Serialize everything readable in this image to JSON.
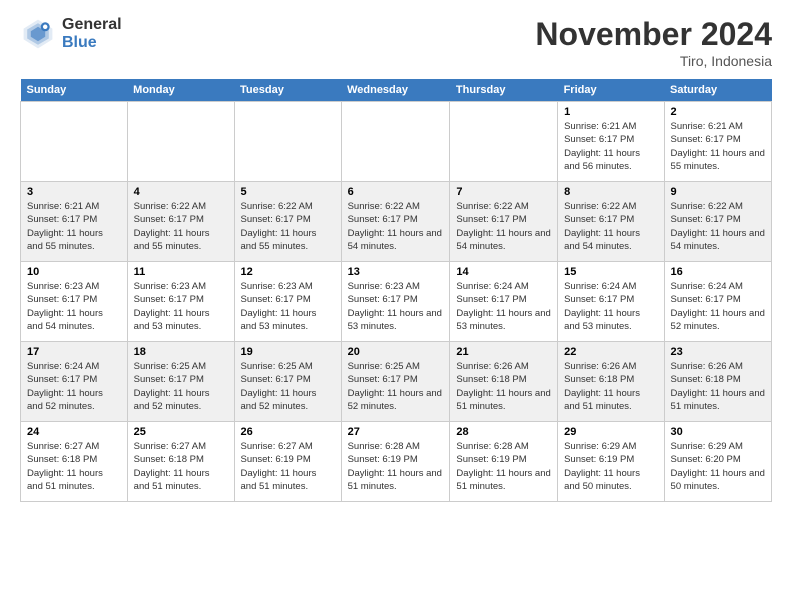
{
  "app": {
    "logo_general": "General",
    "logo_blue": "Blue"
  },
  "header": {
    "title": "November 2024",
    "subtitle": "Tiro, Indonesia"
  },
  "days_of_week": [
    "Sunday",
    "Monday",
    "Tuesday",
    "Wednesday",
    "Thursday",
    "Friday",
    "Saturday"
  ],
  "weeks": [
    {
      "id": "week1",
      "days": [
        {
          "num": "",
          "info": ""
        },
        {
          "num": "",
          "info": ""
        },
        {
          "num": "",
          "info": ""
        },
        {
          "num": "",
          "info": ""
        },
        {
          "num": "",
          "info": ""
        },
        {
          "num": "1",
          "info": "Sunrise: 6:21 AM\nSunset: 6:17 PM\nDaylight: 11 hours and 56 minutes."
        },
        {
          "num": "2",
          "info": "Sunrise: 6:21 AM\nSunset: 6:17 PM\nDaylight: 11 hours and 55 minutes."
        }
      ]
    },
    {
      "id": "week2",
      "days": [
        {
          "num": "3",
          "info": "Sunrise: 6:21 AM\nSunset: 6:17 PM\nDaylight: 11 hours and 55 minutes."
        },
        {
          "num": "4",
          "info": "Sunrise: 6:22 AM\nSunset: 6:17 PM\nDaylight: 11 hours and 55 minutes."
        },
        {
          "num": "5",
          "info": "Sunrise: 6:22 AM\nSunset: 6:17 PM\nDaylight: 11 hours and 55 minutes."
        },
        {
          "num": "6",
          "info": "Sunrise: 6:22 AM\nSunset: 6:17 PM\nDaylight: 11 hours and 54 minutes."
        },
        {
          "num": "7",
          "info": "Sunrise: 6:22 AM\nSunset: 6:17 PM\nDaylight: 11 hours and 54 minutes."
        },
        {
          "num": "8",
          "info": "Sunrise: 6:22 AM\nSunset: 6:17 PM\nDaylight: 11 hours and 54 minutes."
        },
        {
          "num": "9",
          "info": "Sunrise: 6:22 AM\nSunset: 6:17 PM\nDaylight: 11 hours and 54 minutes."
        }
      ]
    },
    {
      "id": "week3",
      "days": [
        {
          "num": "10",
          "info": "Sunrise: 6:23 AM\nSunset: 6:17 PM\nDaylight: 11 hours and 54 minutes."
        },
        {
          "num": "11",
          "info": "Sunrise: 6:23 AM\nSunset: 6:17 PM\nDaylight: 11 hours and 53 minutes."
        },
        {
          "num": "12",
          "info": "Sunrise: 6:23 AM\nSunset: 6:17 PM\nDaylight: 11 hours and 53 minutes."
        },
        {
          "num": "13",
          "info": "Sunrise: 6:23 AM\nSunset: 6:17 PM\nDaylight: 11 hours and 53 minutes."
        },
        {
          "num": "14",
          "info": "Sunrise: 6:24 AM\nSunset: 6:17 PM\nDaylight: 11 hours and 53 minutes."
        },
        {
          "num": "15",
          "info": "Sunrise: 6:24 AM\nSunset: 6:17 PM\nDaylight: 11 hours and 53 minutes."
        },
        {
          "num": "16",
          "info": "Sunrise: 6:24 AM\nSunset: 6:17 PM\nDaylight: 11 hours and 52 minutes."
        }
      ]
    },
    {
      "id": "week4",
      "days": [
        {
          "num": "17",
          "info": "Sunrise: 6:24 AM\nSunset: 6:17 PM\nDaylight: 11 hours and 52 minutes."
        },
        {
          "num": "18",
          "info": "Sunrise: 6:25 AM\nSunset: 6:17 PM\nDaylight: 11 hours and 52 minutes."
        },
        {
          "num": "19",
          "info": "Sunrise: 6:25 AM\nSunset: 6:17 PM\nDaylight: 11 hours and 52 minutes."
        },
        {
          "num": "20",
          "info": "Sunrise: 6:25 AM\nSunset: 6:17 PM\nDaylight: 11 hours and 52 minutes."
        },
        {
          "num": "21",
          "info": "Sunrise: 6:26 AM\nSunset: 6:18 PM\nDaylight: 11 hours and 51 minutes."
        },
        {
          "num": "22",
          "info": "Sunrise: 6:26 AM\nSunset: 6:18 PM\nDaylight: 11 hours and 51 minutes."
        },
        {
          "num": "23",
          "info": "Sunrise: 6:26 AM\nSunset: 6:18 PM\nDaylight: 11 hours and 51 minutes."
        }
      ]
    },
    {
      "id": "week5",
      "days": [
        {
          "num": "24",
          "info": "Sunrise: 6:27 AM\nSunset: 6:18 PM\nDaylight: 11 hours and 51 minutes."
        },
        {
          "num": "25",
          "info": "Sunrise: 6:27 AM\nSunset: 6:18 PM\nDaylight: 11 hours and 51 minutes."
        },
        {
          "num": "26",
          "info": "Sunrise: 6:27 AM\nSunset: 6:19 PM\nDaylight: 11 hours and 51 minutes."
        },
        {
          "num": "27",
          "info": "Sunrise: 6:28 AM\nSunset: 6:19 PM\nDaylight: 11 hours and 51 minutes."
        },
        {
          "num": "28",
          "info": "Sunrise: 6:28 AM\nSunset: 6:19 PM\nDaylight: 11 hours and 51 minutes."
        },
        {
          "num": "29",
          "info": "Sunrise: 6:29 AM\nSunset: 6:19 PM\nDaylight: 11 hours and 50 minutes."
        },
        {
          "num": "30",
          "info": "Sunrise: 6:29 AM\nSunset: 6:20 PM\nDaylight: 11 hours and 50 minutes."
        }
      ]
    }
  ]
}
